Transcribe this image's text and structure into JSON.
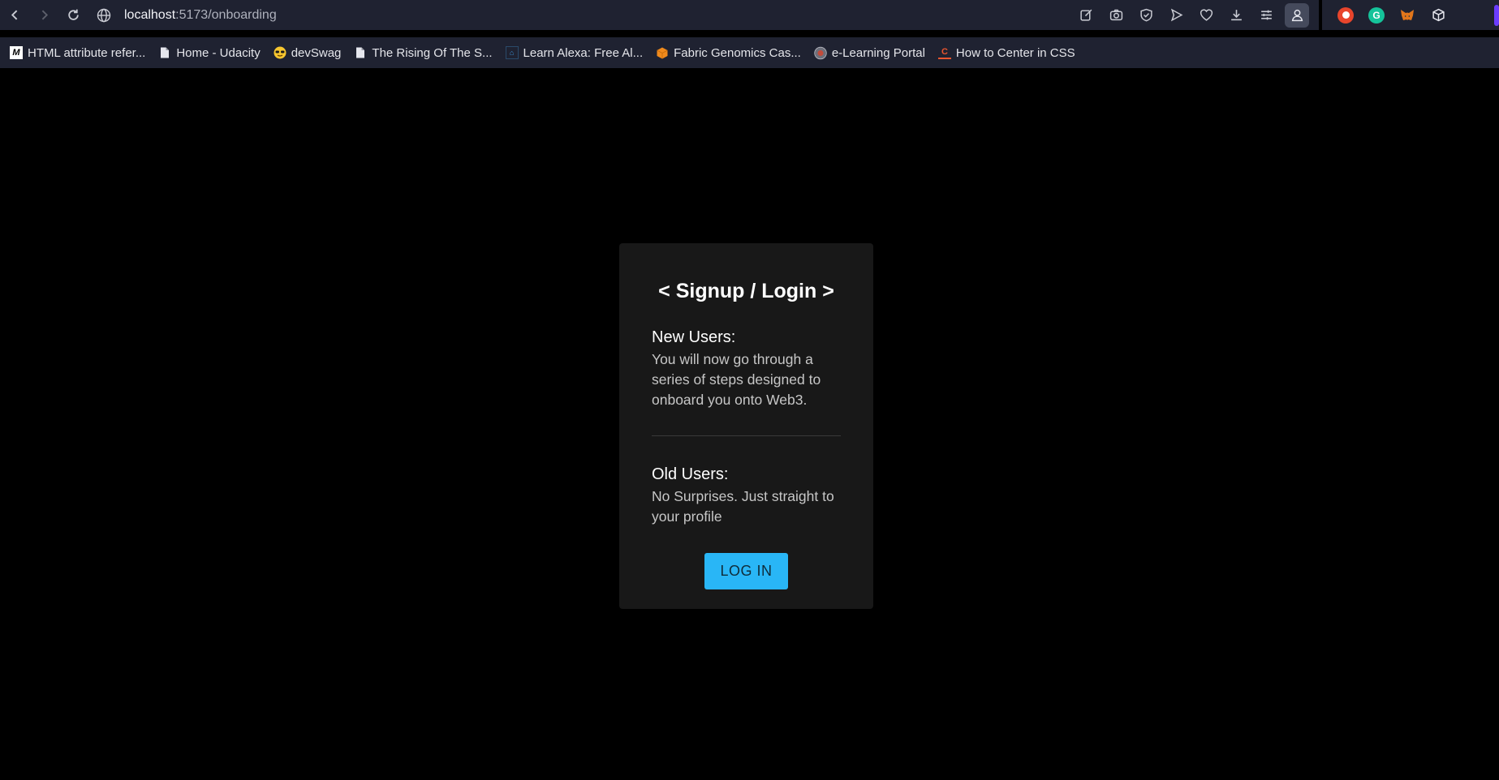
{
  "browser": {
    "url_host": "localhost",
    "url_path": ":5173/onboarding",
    "tools": [
      "edit-icon",
      "camera-icon",
      "shield-check-icon",
      "play-icon",
      "heart-icon",
      "download-icon",
      "sliders-icon",
      "profile-icon"
    ],
    "extensions": [
      "brave-rewards-icon",
      "grammarly-icon",
      "metamask-icon",
      "box-extension-icon"
    ]
  },
  "bookmarks": [
    {
      "label": "HTML attribute refer...",
      "icon": "mdn-icon"
    },
    {
      "label": "Home - Udacity",
      "icon": "page-icon"
    },
    {
      "label": "devSwag",
      "icon": "sunglasses-emoji-icon"
    },
    {
      "label": "The Rising Of The S...",
      "icon": "page-icon"
    },
    {
      "label": "Learn Alexa: Free Al...",
      "icon": "alexa-icon"
    },
    {
      "label": "Fabric Genomics Cas...",
      "icon": "fabric-cube-icon"
    },
    {
      "label": "e-Learning Portal",
      "icon": "portal-logo-icon"
    },
    {
      "label": "How to Center in CSS",
      "icon": "css-c-icon"
    }
  ],
  "card": {
    "title": "< Signup / Login >",
    "new_users": {
      "heading": "New Users:",
      "text": "You will now go through a series of steps designed to onboard you onto Web3."
    },
    "old_users": {
      "heading": "Old Users:",
      "text": "No Surprises. Just straight to your profile"
    },
    "login_label": "LOG IN"
  },
  "colors": {
    "accent": "#29b6f6",
    "card_bg": "#181818",
    "chrome_bg": "#1f2231"
  }
}
